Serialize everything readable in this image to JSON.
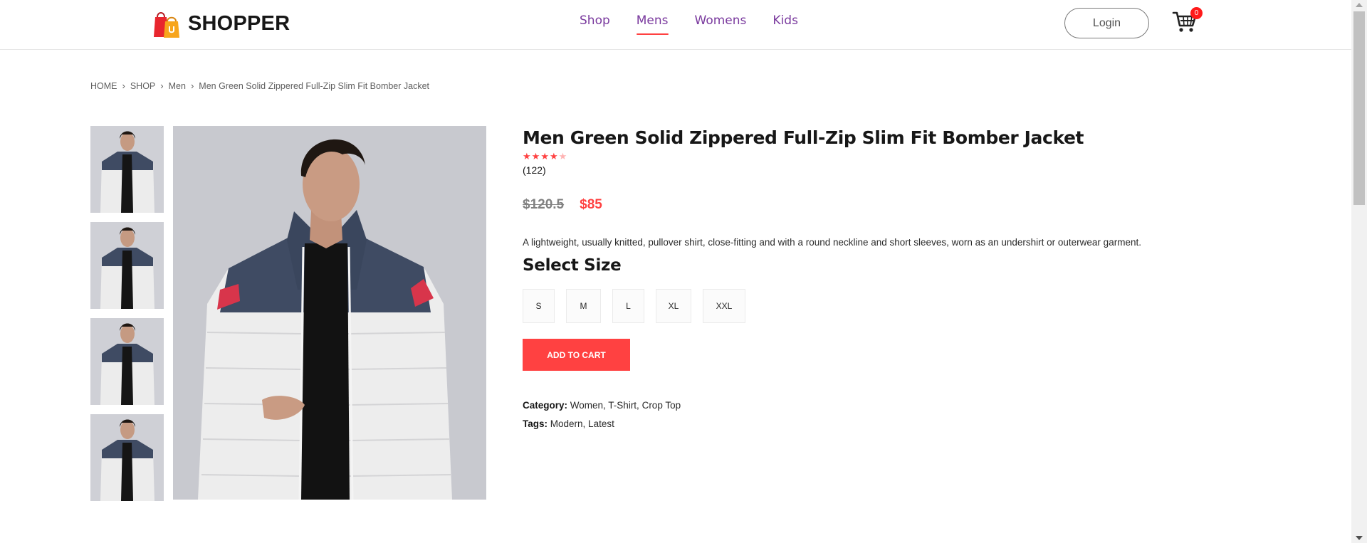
{
  "brand": {
    "name": "SHOPPER"
  },
  "nav": {
    "links": [
      {
        "label": "Shop",
        "active": false
      },
      {
        "label": "Mens",
        "active": true
      },
      {
        "label": "Womens",
        "active": false
      },
      {
        "label": "Kids",
        "active": false
      }
    ],
    "login_label": "Login",
    "cart_count": "0"
  },
  "breadcrumb": [
    "HOME",
    "SHOP",
    "Men",
    "Men Green Solid Zippered Full-Zip Slim Fit Bomber Jacket"
  ],
  "product": {
    "title": "Men Green Solid Zippered Full-Zip Slim Fit Bomber Jacket",
    "rating": 4,
    "rating_max": 5,
    "rating_count": "(122)",
    "old_price": "$120.5",
    "new_price": "$85",
    "description": "A lightweight, usually knitted, pullover shirt, close-fitting and with a round neckline and short sleeves, worn as an undershirt or outerwear garment.",
    "size_title": "Select Size",
    "sizes": [
      "S",
      "M",
      "L",
      "XL",
      "XXL"
    ],
    "add_to_cart_label": "ADD TO CART",
    "category_label": "Category:",
    "category_value": "Women, T-Shirt, Crop Top",
    "tags_label": "Tags:",
    "tags_value": "Modern, Latest"
  },
  "colors": {
    "accent": "#ff4141",
    "nav_link": "#7a3a9e",
    "text": "#171717"
  },
  "icons": {
    "logo": "shopping-bag-logo-icon",
    "cart": "shopping-cart-icon",
    "star": "star-icon"
  }
}
